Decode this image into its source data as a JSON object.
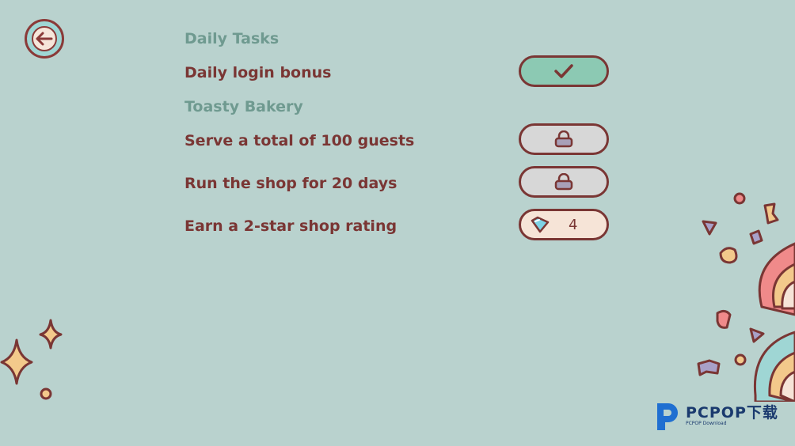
{
  "nav": {
    "back_icon": "back-arrow-icon"
  },
  "sections": [
    {
      "title": "Daily Tasks"
    },
    {
      "title": "Toasty Bakery"
    }
  ],
  "tasks": [
    {
      "label": "Daily login bonus",
      "status": "completed",
      "icon": "checkmark-icon"
    },
    {
      "label": "Serve a total of 100 guests",
      "status": "locked",
      "icon": "lock-icon"
    },
    {
      "label": "Run the shop for 20 days",
      "status": "locked",
      "icon": "lock-icon"
    },
    {
      "label": "Earn a 2-star shop rating",
      "status": "reward",
      "icon": "gem-icon",
      "reward": "4"
    }
  ],
  "watermark": {
    "main": "PCPOP下载",
    "sub": "PCPOP Download"
  },
  "colors": {
    "background": "#b9d2ce",
    "accent_brown": "#7a3634",
    "section_teal": "#6f9a90",
    "completed_green": "#8cc9b3",
    "locked_gray": "#d7d7d7",
    "reward_cream": "#f6e4d7"
  }
}
